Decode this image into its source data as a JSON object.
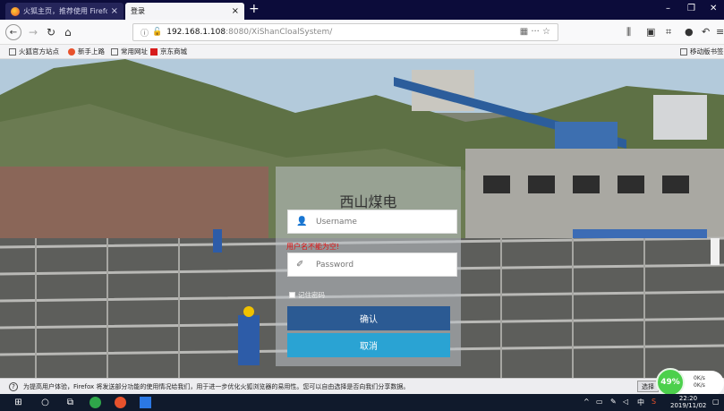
{
  "browser": {
    "tabs": [
      {
        "label": "火狐主页，推荐使用 Firefox",
        "close": "×",
        "active": false
      },
      {
        "label": "登录",
        "close": "×",
        "active": true
      }
    ],
    "new_tab": "+",
    "window_controls": {
      "minimize": "–",
      "maximize": "❐",
      "close": "✕"
    },
    "url_host": "192.168.1.108",
    "url_path": ":8080/XiShanCloalSystem/",
    "url_actions": "▦  ···  ☆",
    "bookmarks": [
      "火狐官方站点",
      "新手上路",
      "常用网址",
      "京东商城"
    ],
    "mobile_bookmarks": "移动版书签"
  },
  "login": {
    "title": "西山煤电",
    "username_placeholder": "Username",
    "password_placeholder": "Password",
    "error": "用户名不能为空!",
    "remember_label": "记住密码",
    "confirm_label": "确认",
    "cancel_label": "取消"
  },
  "notification": {
    "text": "为提高用户体验，Firefox 将发送部分功能的使用情况给我们，用于进一步优化火狐浏览器的易用性。您可以自由选择是否向我们分享数据。",
    "choose_label": "选择"
  },
  "speed_widget": {
    "percent": "49%",
    "up": "0K/s",
    "down": "0K/s"
  },
  "taskbar": {
    "time": "22:20",
    "date": "2019/11/02",
    "ime": "中"
  },
  "colors": {
    "confirm": "#2b5a93",
    "cancel": "#2aa3d3",
    "error": "#e01010",
    "tabbar": "#0c0c3a"
  }
}
